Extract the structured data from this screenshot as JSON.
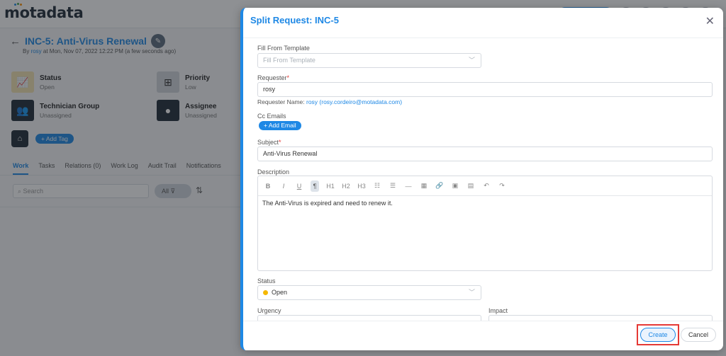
{
  "app": {
    "logo_text": "motadata"
  },
  "ticket": {
    "title": "INC-5: Anti-Virus Renewal",
    "meta_prefix": "By ",
    "meta_user": "rosy",
    "meta_suffix": " at Mon, Nov 07, 2022 12:22 PM (a few seconds ago)"
  },
  "fields": {
    "status": {
      "label": "Status",
      "value": "Open"
    },
    "priority": {
      "label": "Priority",
      "value": "Low"
    },
    "technician_group": {
      "label": "Technician Group",
      "value": "Unassigned"
    },
    "assignee": {
      "label": "Assignee",
      "value": "Unassigned"
    }
  },
  "tags": {
    "add_label": "+ Add Tag"
  },
  "tabs": [
    "Work",
    "Tasks",
    "Relations (0)",
    "Work Log",
    "Audit Trail",
    "Notifications"
  ],
  "work": {
    "search_placeholder": "Search",
    "filter_label": "All"
  },
  "modal": {
    "title": "Split Request: INC-5",
    "template": {
      "label": "Fill From Template",
      "placeholder": "Fill From Template"
    },
    "requester": {
      "label": "Requester",
      "value": "rosy",
      "name_prefix": "Requester Name: ",
      "name_value": "rosy (rosy.cordeiro@motadata.com)"
    },
    "cc": {
      "label": "Cc Emails",
      "add_label": "+ Add Email"
    },
    "subject": {
      "label": "Subject",
      "value": "Anti-Virus Renewal"
    },
    "description": {
      "label": "Description",
      "toolbar": [
        "B",
        "I",
        "U",
        "¶",
        "H1",
        "H2",
        "H3",
        "☷",
        "☰",
        "—",
        "▦",
        "🔗",
        "▣",
        "▤",
        "↶",
        "↷"
      ],
      "text": "The Anti-Virus is expired and need to renew it."
    },
    "status": {
      "label": "Status",
      "value": "Open",
      "dot_color": "#f5b800"
    },
    "urgency": {
      "label": "Urgency"
    },
    "impact": {
      "label": "Impact"
    },
    "create_label": "Create",
    "cancel_label": "Cancel"
  }
}
